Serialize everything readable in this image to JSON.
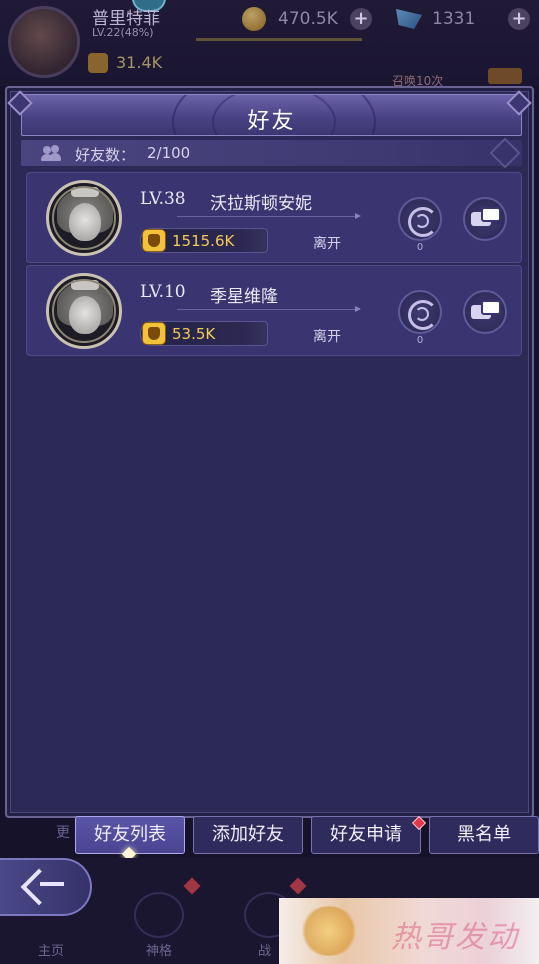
{
  "hud": {
    "player_name": "普里特菲",
    "player_level": "LV.22(48%)",
    "gold": "470.5K",
    "gems": "1331",
    "power": "31.4K",
    "summon_text": "召唤10次"
  },
  "panel": {
    "title": "好友",
    "count_label": "好友数：",
    "count_value": "2/100"
  },
  "friends": [
    {
      "level": "LV.38",
      "name": "沃拉斯顿安妮",
      "power": "1515.6K",
      "status": "离开",
      "gift_count": "0"
    },
    {
      "level": "LV.10",
      "name": "季星维隆",
      "power": "53.5K",
      "status": "离开",
      "gift_count": "0"
    }
  ],
  "tabs": {
    "more": "更",
    "items": [
      "好友列表",
      "添加好友",
      "好友申请",
      "黑名单"
    ],
    "active_index": 0
  },
  "nav": {
    "items": [
      "主页",
      "神格",
      "战"
    ]
  },
  "ad": {
    "text": "热哥发动"
  },
  "colors": {
    "panel_bg": "#2d2956",
    "row_bg": "#3a3570",
    "power_text": "#f3cc52",
    "notify_dot": "#e0384d"
  }
}
